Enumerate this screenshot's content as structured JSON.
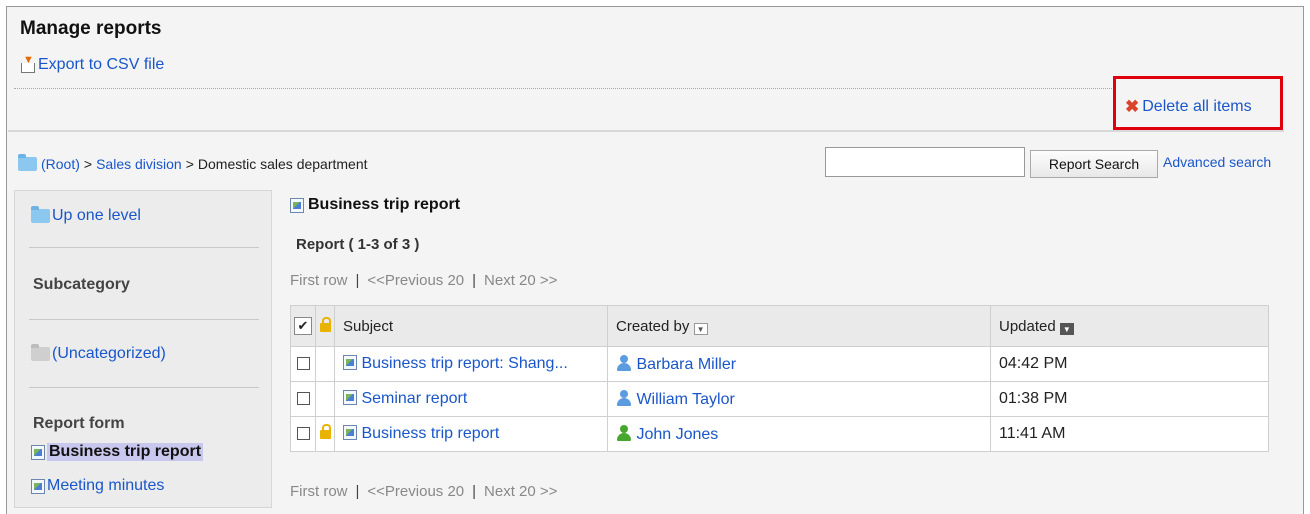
{
  "page_title": "Manage reports",
  "export_label": "Export to CSV file",
  "delete_all_label": "Delete all items",
  "breadcrumb": {
    "root": "(Root)",
    "sep1": ">",
    "level1": "Sales division",
    "sep2": ">",
    "current": "Domestic sales department"
  },
  "search": {
    "value": "",
    "button_label": "Report Search",
    "advanced_label": "Advanced search"
  },
  "sidebar": {
    "up_label": "Up one level",
    "subcategory_heading": "Subcategory",
    "uncategorized_label": "(Uncategorized)",
    "report_form_heading": "Report form",
    "forms": [
      {
        "label": "Business trip report",
        "selected": true
      },
      {
        "label": "Meeting minutes",
        "selected": false
      }
    ]
  },
  "main": {
    "form_title": "Business trip report",
    "count_text": "Report ( 1-3 of 3 )",
    "pager": {
      "first": "First row",
      "prev": "<<Previous 20",
      "next": "Next 20 >>",
      "sep": "|"
    },
    "columns": {
      "check": "✔",
      "subject": "Subject",
      "created_by": "Created by",
      "updated": "Updated"
    },
    "rows": [
      {
        "locked": false,
        "subject": "Business trip report: Shang...",
        "created_by": "Barbara Miller",
        "user_color": "#5b9be0",
        "updated": "04:42 PM"
      },
      {
        "locked": false,
        "subject": "Seminar report",
        "created_by": "William Taylor",
        "user_color": "#5b9be0",
        "updated": "01:38 PM"
      },
      {
        "locked": true,
        "subject": "Business trip report",
        "created_by": "John Jones",
        "user_color": "#46a62e",
        "updated": "11:41 AM"
      }
    ]
  },
  "colors": {
    "link": "#1a56c9",
    "highlight_border": "#e0000b",
    "delete_icon": "#d9432a"
  }
}
